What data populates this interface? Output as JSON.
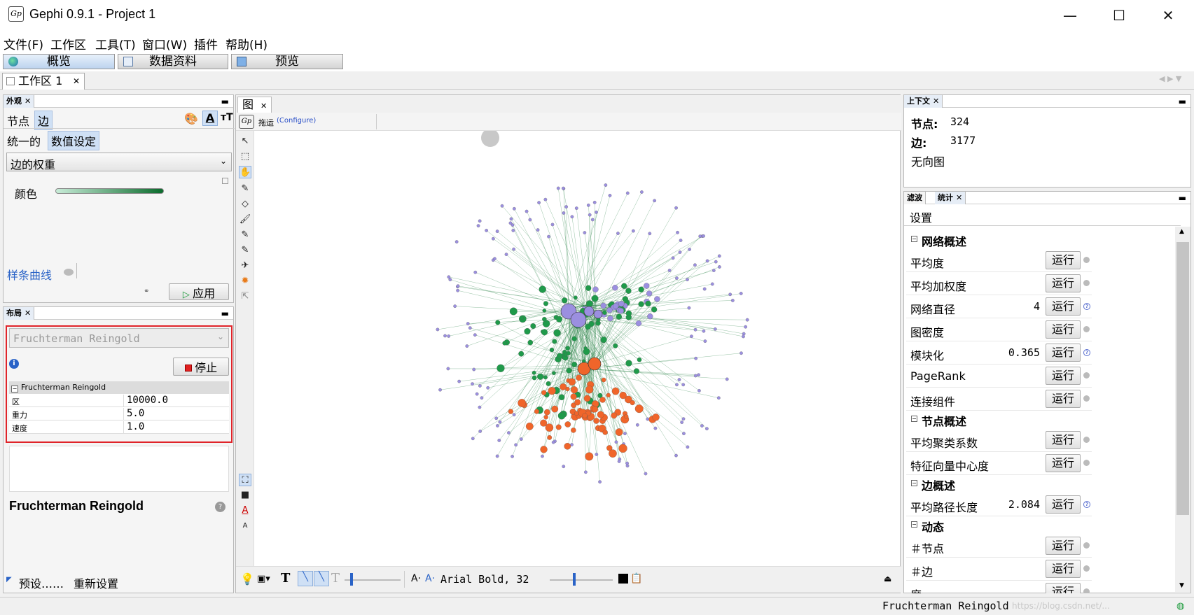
{
  "window": {
    "title": "Gephi 0.9.1 - Project 1",
    "logo_text": "Gp",
    "minimize": "—",
    "maximize": "☐",
    "close": "✕"
  },
  "menu": [
    "文件(F)",
    "工作区",
    "工具(T)",
    "窗口(W)",
    "插件",
    "帮助(H)"
  ],
  "main_tabs": [
    "概览",
    "数据资料",
    "预览"
  ],
  "workspace_tab": {
    "label": "工作区 1",
    "close": "✕"
  },
  "appearance": {
    "tab_label": "外观",
    "tabs": [
      "节点",
      "边"
    ],
    "modes": [
      "统一的",
      "数值设定"
    ],
    "attribute_select": "边的权重",
    "color_label": "颜色",
    "gradient_start": "#c8ecd8",
    "gradient_end": "#0b6b2c",
    "spline_label": "样条曲线",
    "apply_label": "应用"
  },
  "layout": {
    "tab_label": "布局",
    "algorithm": "Fruchterman Reingold",
    "stop_label": "停止",
    "group_label": "Fruchterman Reingold",
    "props": [
      {
        "key": "区",
        "value": "10000.0"
      },
      {
        "key": "重力",
        "value": "5.0"
      },
      {
        "key": "速度",
        "value": "1.0"
      }
    ],
    "desc_title": "Fruchterman Reingold",
    "presets_label": "预设……",
    "reset_label": "重新设置"
  },
  "graph": {
    "tab_label": "图",
    "mode_label": "拖运",
    "configure_label": "(Configure)",
    "font_label": "Arial Bold, 32",
    "node_purple": "#9b8fe0",
    "node_green": "#1f9a4a",
    "node_orange": "#f0652a",
    "edge_color": "#1a7a3a"
  },
  "context": {
    "tab_label": "上下文",
    "nodes_label": "节点:",
    "nodes_value": "324",
    "edges_label": "边:",
    "edges_value": "3177",
    "graph_type": "无向图"
  },
  "statistics": {
    "tabs": [
      "滤波",
      "统计"
    ],
    "settings_label": "设置",
    "run_label": "运行",
    "sections": [
      {
        "title": "网络概述",
        "items": [
          {
            "name": "平均度",
            "value": "",
            "status": "dot"
          },
          {
            "name": "平均加权度",
            "value": "",
            "status": "dot"
          },
          {
            "name": "网络直径",
            "value": "4",
            "status": "help"
          },
          {
            "name": "图密度",
            "value": "",
            "status": "dot"
          },
          {
            "name": "模块化",
            "value": "0.365",
            "status": "help"
          },
          {
            "name": "PageRank",
            "value": "",
            "status": "dot"
          },
          {
            "name": "连接组件",
            "value": "",
            "status": "dot"
          }
        ]
      },
      {
        "title": "节点概述",
        "items": [
          {
            "name": "平均聚类系数",
            "value": "",
            "status": "dot"
          },
          {
            "name": "特征向量中心度",
            "value": "",
            "status": "dot"
          }
        ]
      },
      {
        "title": "边概述",
        "items": [
          {
            "name": "平均路径长度",
            "value": "2.084",
            "status": "help"
          }
        ]
      },
      {
        "title": "动态",
        "items": [
          {
            "name": "＃节点",
            "value": "",
            "status": "dot"
          },
          {
            "name": "＃边",
            "value": "",
            "status": "dot"
          },
          {
            "name": "度",
            "value": "",
            "status": "dot"
          }
        ]
      }
    ]
  },
  "status_bar": {
    "text": "Fruchterman Reingold",
    "watermark": "https://blog.csdn.net/..."
  }
}
